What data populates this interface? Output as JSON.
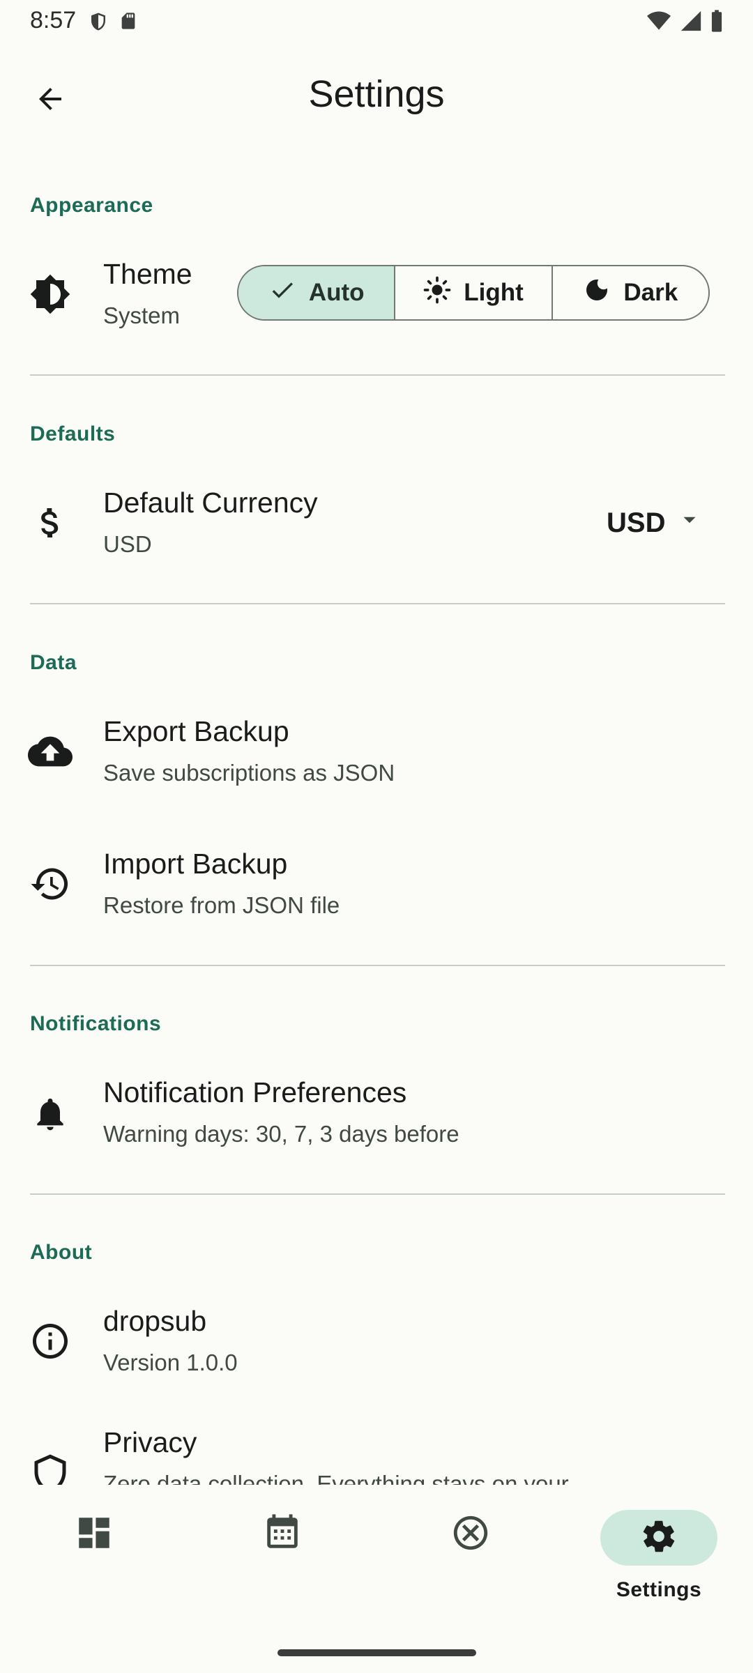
{
  "status_bar": {
    "time": "8:57",
    "left_icons": [
      "shield-icon",
      "sd-card-icon"
    ],
    "right_icons": [
      "wifi-icon",
      "signal-icon",
      "battery-icon"
    ]
  },
  "app_bar": {
    "title": "Settings",
    "back_icon": "arrow-back-icon"
  },
  "sections": {
    "appearance": {
      "header": "Appearance",
      "theme": {
        "title": "Theme",
        "subtitle": "System",
        "icon": "brightness-icon",
        "options": [
          {
            "label": "Auto",
            "icon": "check-icon",
            "selected": true
          },
          {
            "label": "Light",
            "icon": "sun-icon",
            "selected": false
          },
          {
            "label": "Dark",
            "icon": "moon-icon",
            "selected": false
          }
        ]
      }
    },
    "defaults": {
      "header": "Defaults",
      "currency": {
        "title": "Default Currency",
        "subtitle": "USD",
        "icon": "dollar-icon",
        "selected_value": "USD"
      }
    },
    "data": {
      "header": "Data",
      "export": {
        "title": "Export Backup",
        "subtitle": "Save subscriptions as JSON",
        "icon": "cloud-upload-icon"
      },
      "import": {
        "title": "Import Backup",
        "subtitle": "Restore from JSON file",
        "icon": "history-icon"
      }
    },
    "notifications": {
      "header": "Notifications",
      "preferences": {
        "title": "Notification Preferences",
        "subtitle": "Warning days: 30, 7, 3 days before",
        "icon": "bell-icon"
      }
    },
    "about": {
      "header": "About",
      "app": {
        "title": "dropsub",
        "subtitle": "Version 1.0.0",
        "icon": "info-icon"
      },
      "privacy": {
        "title": "Privacy",
        "subtitle": "Zero data collection. Everything stays on your",
        "icon": "shield-icon"
      }
    }
  },
  "bottom_nav": [
    {
      "icon": "dashboard-icon",
      "label": "",
      "selected": false
    },
    {
      "icon": "calendar-icon",
      "label": "",
      "selected": false
    },
    {
      "icon": "cancel-icon",
      "label": "",
      "selected": false
    },
    {
      "icon": "settings-icon",
      "label": "Settings",
      "selected": true
    }
  ],
  "colors": {
    "accent": "#1b6b56",
    "selected_container": "#cde8dc",
    "background": "#fbfcf7",
    "divider": "#c6ccc7"
  }
}
